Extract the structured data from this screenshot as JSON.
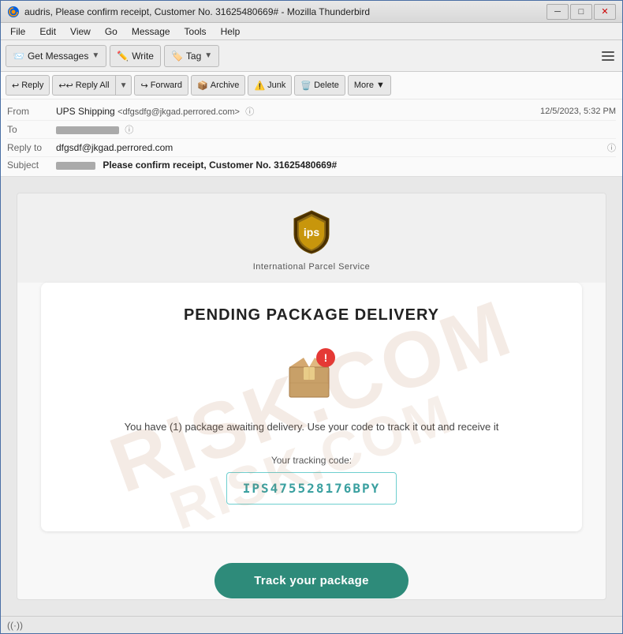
{
  "window": {
    "title": "audris, Please confirm receipt, Customer No. 31625480669# - Mozilla Thunderbird",
    "minimize_label": "─",
    "maximize_label": "□",
    "close_label": "✕"
  },
  "menu": {
    "items": [
      "File",
      "Edit",
      "View",
      "Go",
      "Message",
      "Tools",
      "Help"
    ]
  },
  "toolbar": {
    "get_messages_label": "Get Messages",
    "write_label": "Write",
    "tag_label": "Tag",
    "hamburger_title": "Menu"
  },
  "email_toolbar": {
    "reply_label": "Reply",
    "reply_all_label": "Reply All",
    "forward_label": "Forward",
    "archive_label": "Archive",
    "junk_label": "Junk",
    "delete_label": "Delete",
    "more_label": "More"
  },
  "email_header": {
    "from_label": "From",
    "from_name": "UPS Shipping",
    "from_email": "<dfgsdfg@jkgad.perrored.com>",
    "to_label": "To",
    "reply_to_label": "Reply to",
    "reply_to_value": "dfgsdf@jkgad.perrored.com",
    "subject_label": "Subject",
    "subject_prefix": "Please confirm receipt, Customer No. 31625480669#",
    "date": "12/5/2023, 5:32 PM"
  },
  "email_body": {
    "logo_tagline": "International Parcel Service",
    "pending_title": "PENDING PACKAGE DELIVERY",
    "body_text": "You have (1) package awaiting delivery. Use your code\nto track it out and receive it",
    "tracking_label": "Your tracking code:",
    "tracking_code": "IPS475528176BPY",
    "track_btn_label": "Track your package"
  },
  "watermark": {
    "line1": "RISK.COM",
    "line2": "RISK.COM"
  },
  "status_bar": {
    "icon": "((·))",
    "text": ""
  }
}
